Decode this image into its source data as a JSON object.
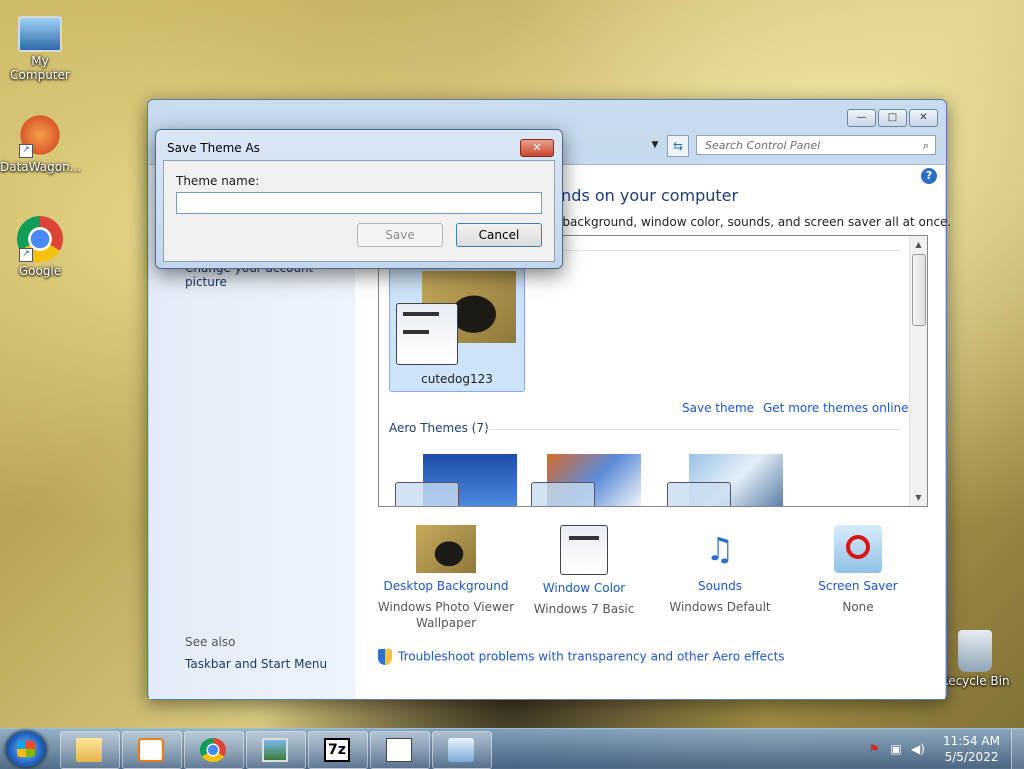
{
  "desktop": {
    "icons": [
      {
        "label": "My Computer"
      },
      {
        "label": "DataWagon..."
      },
      {
        "label": "Google"
      },
      {
        "label": "Recycle Bin"
      }
    ]
  },
  "window": {
    "controls": {
      "minimize": "—",
      "maximize": "□",
      "close": "✕"
    },
    "search_placeholder": "Search Control Panel",
    "sidebar": {
      "change_account_picture": "Change your account picture",
      "see_also": "See also",
      "taskbar_start_menu": "Taskbar and Start Menu"
    },
    "main_title": "unds on your computer",
    "main_desc": "p background, window color, sounds, and screen saver all at once.",
    "themes": {
      "my_theme_label": "cutedog123",
      "save_theme": "Save theme",
      "get_more_themes": "Get more themes online",
      "aero_heading": "Aero Themes (7)"
    },
    "bottom_items": [
      {
        "title": "Desktop Background",
        "sub1": "Windows Photo Viewer",
        "sub2": "Wallpaper"
      },
      {
        "title": "Window Color",
        "sub1": "Windows 7 Basic",
        "sub2": ""
      },
      {
        "title": "Sounds",
        "sub1": "Windows Default",
        "sub2": ""
      },
      {
        "title": "Screen Saver",
        "sub1": "None",
        "sub2": ""
      }
    ],
    "troubleshoot": "Troubleshoot problems with transparency and other Aero effects"
  },
  "dialog": {
    "title": "Save Theme As",
    "field_label": "Theme name:",
    "field_value": "",
    "save_label": "Save",
    "cancel_label": "Cancel",
    "close_glyph": "✕"
  },
  "taskbar": {
    "time": "11:54 AM",
    "date": "5/5/2022",
    "seven_zip": "7z"
  }
}
